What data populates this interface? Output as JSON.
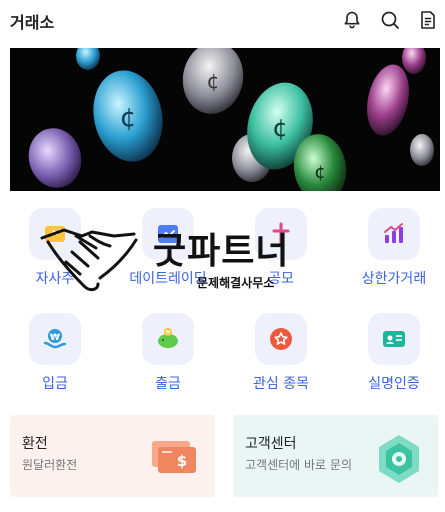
{
  "header": {
    "title": "거래소",
    "icons": [
      "bell-icon",
      "search-icon",
      "document-icon"
    ]
  },
  "banner": {
    "image": "coins-banner"
  },
  "menu_row1": [
    {
      "label": "자사주",
      "icon": "company-stock-icon"
    },
    {
      "label": "데이트레이딩",
      "icon": "day-trading-icon"
    },
    {
      "label": "공모",
      "icon": "public-offering-icon"
    },
    {
      "label": "상한가거래",
      "icon": "upper-limit-chart-icon"
    }
  ],
  "menu_row2": [
    {
      "label": "입금",
      "icon": "deposit-coin-icon"
    },
    {
      "label": "출금",
      "icon": "withdraw-piggy-icon"
    },
    {
      "label": "관심 종목",
      "icon": "favorite-star-icon"
    },
    {
      "label": "실명인증",
      "icon": "id-card-icon"
    }
  ],
  "cards": {
    "exchange": {
      "title": "환전",
      "subtitle": "원달러환전"
    },
    "support": {
      "title": "고객센터",
      "subtitle": "고객센터에 바로 문의"
    }
  },
  "watermark": {
    "title": "굿파트너",
    "subtitle": "문제해결사무소"
  },
  "colors": {
    "accent": "#3b63e0",
    "tile": "#eef0fb",
    "exchange_card": "#fdf1ed",
    "support_card": "#eaf6f3"
  }
}
